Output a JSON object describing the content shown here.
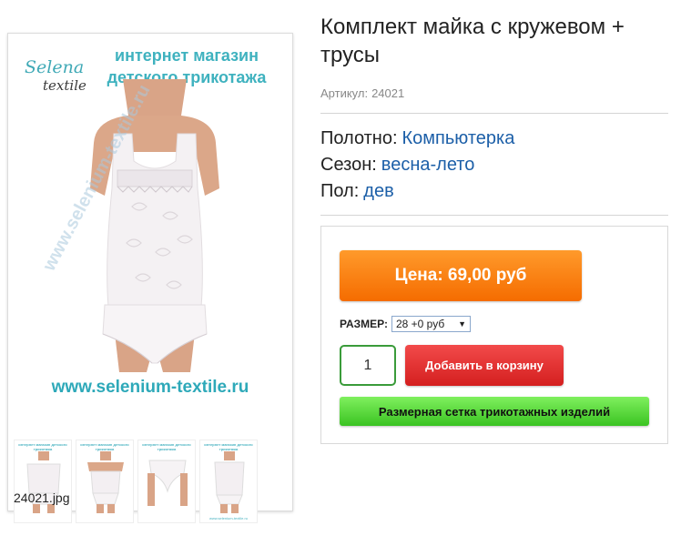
{
  "gallery": {
    "logo_line1": "Selena",
    "logo_line2": "textile",
    "brand_title": "интернет магазин детского трикотажа",
    "watermark": "www.selenium-textile.ru",
    "site_url": "www.selenium-textile.ru",
    "thumb_caption": "интернет магазин детского трикотажа",
    "thumb_footer": "www.selenium-textile.ru",
    "file_name": "24021.jpg"
  },
  "product": {
    "title": "Комплект майка с кружевом + трусы",
    "sku_label": "Артикул:",
    "sku_value": "24021",
    "attributes": [
      {
        "label": "Полотно:",
        "value": "Компьютерка"
      },
      {
        "label": "Сезон:",
        "value": "весна-лето"
      },
      {
        "label": "Пол:",
        "value": "дев"
      }
    ]
  },
  "buy_box": {
    "price_label": "Цена: 69,00 руб",
    "size_label": "РАЗМЕР:",
    "size_selected": "28 +0 руб",
    "quantity": "1",
    "cart_label": "Добавить в корзину",
    "size_chart_label": "Размерная сетка трикотажных изделий"
  },
  "colors": {
    "accent_link": "#1c5fa8",
    "price_button": "#f56c00",
    "cart_button": "#d41f1f",
    "size_chart_button": "#3bc322",
    "brand_teal": "#3fb2bf"
  }
}
